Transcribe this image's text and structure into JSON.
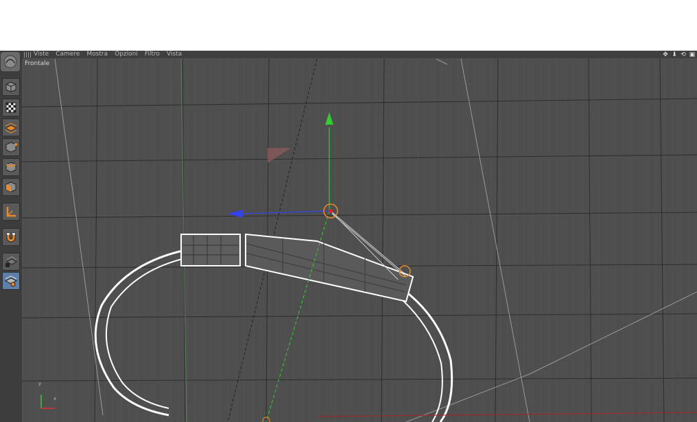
{
  "menu": {
    "items": [
      "Viste",
      "Camere",
      "Mostra",
      "Opzioni",
      "Filtro",
      "Vista"
    ]
  },
  "viewport": {
    "label": "Frontale",
    "axis_y": "y",
    "axis_x": "x"
  },
  "nav_icons": [
    "move-view-icon",
    "zoom-view-icon",
    "rotate-view-icon",
    "maximize-view-icon"
  ],
  "tools": [
    {
      "name": "model-mode-icon",
      "active": false
    },
    {
      "name": "texture-mode-icon",
      "active": false
    },
    {
      "name": "workplane-mode-icon",
      "active": false
    },
    {
      "name": "points-mode-icon",
      "active": false
    },
    {
      "name": "edges-mode-icon",
      "active": false
    },
    {
      "name": "polygons-mode-icon",
      "active": false
    },
    {
      "name": "axis-mode-icon",
      "active": false
    },
    {
      "name": "snap-magnet-icon",
      "active": false
    },
    {
      "name": "locked-workplane-icon",
      "active": false
    },
    {
      "name": "planar-workplane-icon",
      "active": true
    }
  ],
  "colors": {
    "background": "#4e4e4e",
    "grid": "#5c5c5c",
    "grid_major": "#2b2b2b",
    "axis_y": "#33cc33",
    "axis_x": "#3344ee",
    "gizmo_center": "#dd2222",
    "selection": "#ffffff",
    "active_tool": "#5e7fa7"
  }
}
